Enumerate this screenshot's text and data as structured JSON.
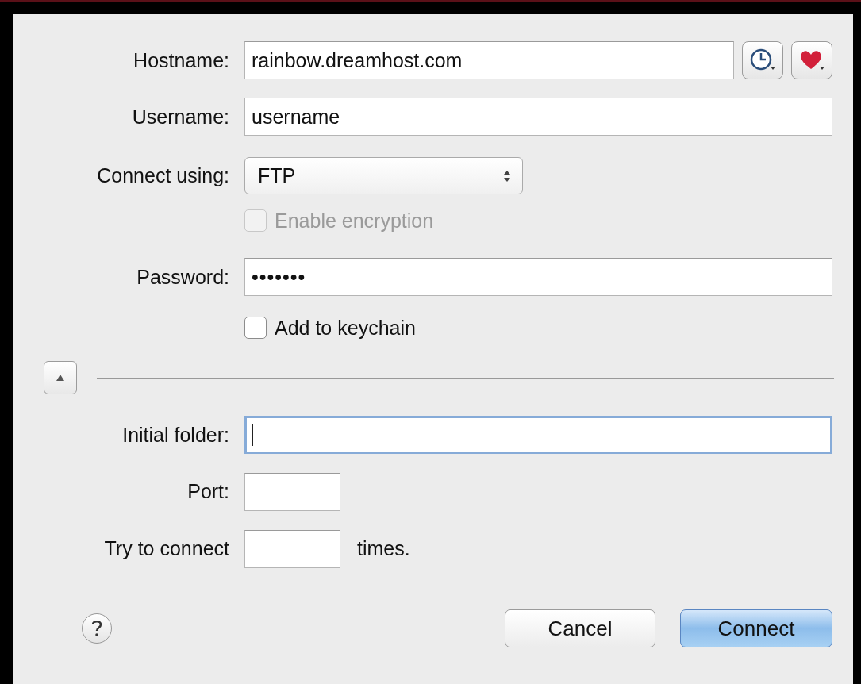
{
  "hostname": {
    "label": "Hostname:",
    "value": "rainbow.dreamhost.com"
  },
  "username": {
    "label": "Username:",
    "value": "username"
  },
  "connect_using": {
    "label": "Connect using:",
    "value": "FTP"
  },
  "enable_encryption": {
    "label": "Enable encryption",
    "checked": false,
    "disabled": true
  },
  "password": {
    "label": "Password:",
    "value": "•••••••"
  },
  "add_to_keychain": {
    "label": "Add to keychain",
    "checked": false,
    "disabled": false
  },
  "advanced_toggle": {
    "expanded": true
  },
  "initial_folder": {
    "label": "Initial folder:",
    "focused": true
  },
  "port": {
    "label": "Port:"
  },
  "retry": {
    "label": "Try to connect",
    "suffix": "times."
  },
  "buttons": [
    {
      "label": "Cancel",
      "kind": "normal"
    },
    {
      "label": "Connect",
      "kind": "default"
    }
  ]
}
